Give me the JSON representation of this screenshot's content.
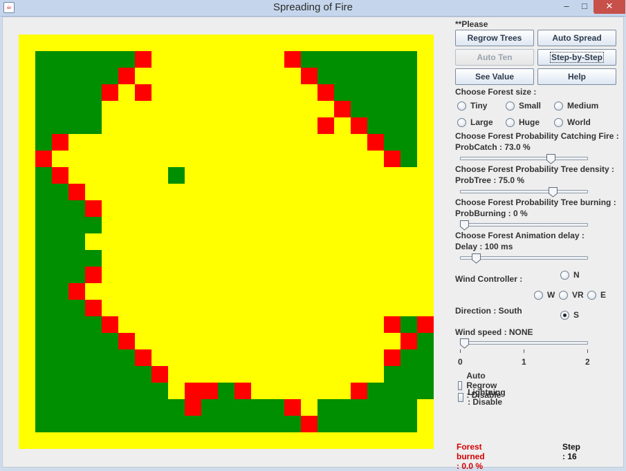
{
  "window": {
    "title": "Spreading of Fire",
    "minimize_glyph": "–",
    "maximize_glyph": "□",
    "close_glyph": "✕",
    "icon": "java-cup-icon"
  },
  "colors": {
    "background": "#ffff00",
    "tree": "#008f00",
    "fire": "#ff0000"
  },
  "forest": {
    "grid_size": 25,
    "legend": "Y = empty ground (yellow), G = tree (green), R = burning (red)",
    "rows": [
      "YYYYYYYYYYYYYYYYYYYYYYYYY",
      "YGGGGGGRYYYYYYYYRGGGGGGGY",
      "YGGGGGRYYYYYYYYYYRGGGGGGY",
      "YGGGGRYRYYYYYYYYYYRGGGGGY",
      "YGGGGYYYYYYYYYYYYYYRGGGGY",
      "YGGGGYYYYYYYYYYYYYRYRGGGY",
      "YGRYYYYYYYYYYYYYYYYYYRGGY",
      "YRYYYYYYYYYYYYYYYYYYYYRGY",
      "YGRYYYYYYGYYYYYYYYYYYYYYY",
      "YGGRYYYYYYYYYYYYYYYYYYYYY",
      "YGGGRYYYYYYYYYYYYYYYYYYYY",
      "YGGGGYYYYYYYYYYYYYYYYYYYY",
      "YGGGYYYYYYYYYYYYYYYYYYYYY",
      "YGGGGYYYYYYYYYYYYYYYYYYYY",
      "YGGGRYYYYYYYYYYYYYYYYYYYY",
      "YGGRYYYYYYYYYYYYYYYYYYYYY",
      "YGGGRYYYYYYYYYYYYYYYYYYYY",
      "YGGGGRYYYYYYYYYYYYYYYYRGR",
      "YGGGGGRYYYYYYYYYYYYYYYYRG",
      "YGGGGGGRYYYYYYYYYYYYYYRGG",
      "YGGGGGGGRYYYYYYYYYYYYYGGG",
      "YGGGGGGGGYRRGRYYYYYYRGGGG",
      "YGGGGGGGGGRGGGGGRYGGGGGGY",
      "YGGGGGGGGGGGGGGGGRGGGGGGY",
      "YYYYYYYYYYYYYYYYYYYYYYYYY"
    ]
  },
  "panel": {
    "hint": "**Please setting and regrow trees**",
    "buttons": {
      "regrow": "Regrow Trees",
      "auto_spread": "Auto Spread",
      "auto_ten": "Auto Ten",
      "step_by_step": "Step-by-Step",
      "see_value": "See Value",
      "help": "Help"
    },
    "forest_size": {
      "label": "Choose Forest size :",
      "options": [
        "Tiny",
        "Small",
        "Medium",
        "Large",
        "Huge",
        "World"
      ]
    },
    "prob_catch": {
      "label": "Choose Forest Probability Catching Fire :",
      "value_text": "ProbCatch : 73.0 %",
      "value": 0.73
    },
    "prob_tree": {
      "label": "Choose Forest Probability Tree density :",
      "value_text": "ProbTree : 75.0 %",
      "value": 0.75
    },
    "prob_burning": {
      "label": "Choose Forest Probability Tree burning :",
      "value_text": "ProbBurning : 0 %",
      "value": 0.0
    },
    "delay": {
      "label": "Choose Forest Animation delay :",
      "value_text": "Delay : 100 ms",
      "value": 0.1
    },
    "wind": {
      "label": "Wind Controller :",
      "n": "N",
      "w": "W",
      "vr": "VR",
      "e": "E",
      "s": "S",
      "selected": "S",
      "direction_text": "Direction : South"
    },
    "wind_speed": {
      "label": "Wind speed : NONE",
      "value": 0,
      "ticks": [
        "0",
        "1",
        "2"
      ]
    },
    "auto_regrow": "Auto Regrow : Disable",
    "lightning": "Lightning : Disable",
    "burned": "Forest burned : 0.0 %",
    "step": "Step : 16"
  }
}
